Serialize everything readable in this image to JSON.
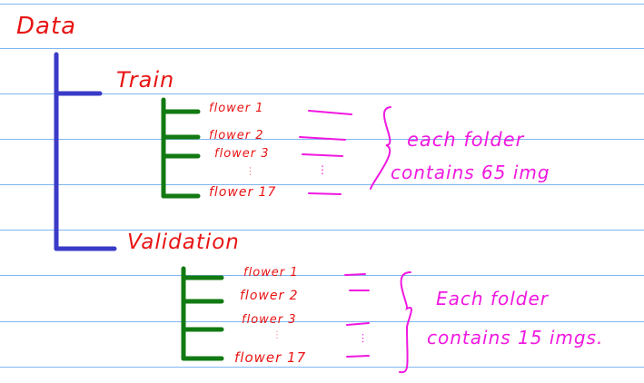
{
  "colors": {
    "rule": "#7fb6f0",
    "root_tree": "#3a3ac8",
    "sub_tree": "#127a12",
    "label": "#e81414",
    "note": "#f018e0"
  },
  "root": {
    "label": "Data"
  },
  "train": {
    "label": "Train",
    "items": [
      "flower 1",
      "flower 2",
      "flower 3",
      "flower 17"
    ],
    "ellipsis": "⋮",
    "note_line1": "each folder",
    "note_line2": "contains 65 img"
  },
  "validation": {
    "label": "Validation",
    "items": [
      "flower 1",
      "flower 2",
      "flower 3",
      "flower 17"
    ],
    "ellipsis": "⋮",
    "note_line1": "Each folder",
    "note_line2": "contains 15 imgs."
  }
}
